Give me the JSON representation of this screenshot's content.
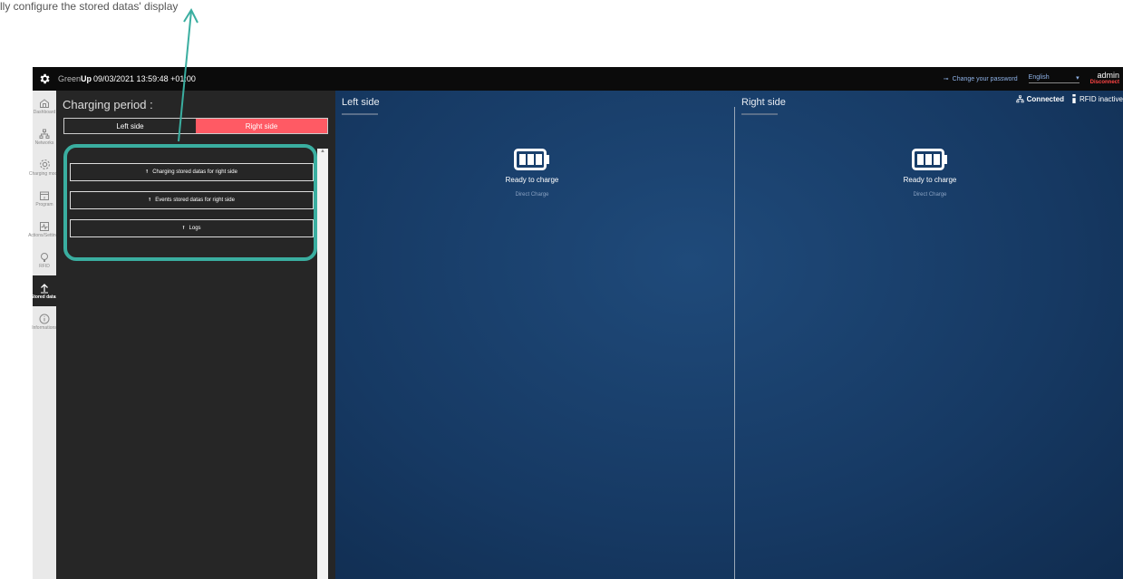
{
  "caption": "lly configure the stored datas' display of the charging station.",
  "topbar": {
    "brand_prefix": "Green",
    "brand_bold": "Up",
    "datetime": "09/03/2021 13:59:48 +01:00",
    "change_password": "Change your password",
    "language": "English",
    "username": "admin",
    "disconnect": "Disconnect"
  },
  "sidebar": {
    "items": [
      {
        "label": "Dashboard",
        "icon": "home-icon"
      },
      {
        "label": "Networks",
        "icon": "network-icon"
      },
      {
        "label": "Charging mode",
        "icon": "gear-icon"
      },
      {
        "label": "Program",
        "icon": "calendar-icon"
      },
      {
        "label": "Actions/Settings",
        "icon": "activity-icon"
      },
      {
        "label": "RFID",
        "icon": "rfid-icon"
      },
      {
        "label": "Stored datas",
        "icon": "upload-icon"
      },
      {
        "label": "Informations",
        "icon": "info-icon"
      }
    ]
  },
  "panel": {
    "title": "Charging period :",
    "tabs": [
      "Left side",
      "Right side"
    ],
    "active_tab": "Right side",
    "buttons": [
      "Charging stored datas for right side",
      "Events stored datas for right side",
      "Logs"
    ]
  },
  "status": {
    "connected": "Connected",
    "rfid": "RFID inactive"
  },
  "sides": [
    {
      "title": "Left side",
      "state": "Ready to charge",
      "mode": "Direct Charge"
    },
    {
      "title": "Right side",
      "state": "Ready to charge",
      "mode": "Direct Charge"
    }
  ],
  "colors": {
    "accent": "#ff5a64",
    "highlight": "#3aaea0",
    "main_bg": "#163963"
  }
}
